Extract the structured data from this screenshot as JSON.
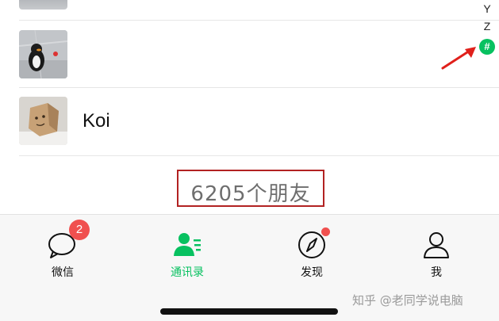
{
  "contacts": [
    {
      "name": "",
      "avatar": "grey-photo-avatar"
    },
    {
      "name": "",
      "avatar": "penguin-figure-avatar"
    },
    {
      "name": "Koi",
      "avatar": "cardboard-box-face-avatar"
    }
  ],
  "index_bar": {
    "letters": [
      "Y",
      "Z"
    ],
    "hash": "#",
    "hash_color": "#07c160"
  },
  "annotation_arrow": {
    "color": "#e0201b",
    "icon": "red-arrow-icon"
  },
  "footer": {
    "friend_count": "6205个朋友",
    "highlight_border_color": "#b22222"
  },
  "tabbar": {
    "tabs": [
      {
        "label": "微信",
        "icon": "chat-bubble-icon",
        "badge": "2",
        "active": false
      },
      {
        "label": "通讯录",
        "icon": "contacts-icon",
        "active": true
      },
      {
        "label": "发现",
        "icon": "compass-icon",
        "dot": true,
        "active": false
      },
      {
        "label": "我",
        "icon": "person-icon",
        "active": false
      }
    ],
    "active_color": "#07c160",
    "badge_color": "#f0504f"
  },
  "watermark": "知乎 @老同学说电脑"
}
